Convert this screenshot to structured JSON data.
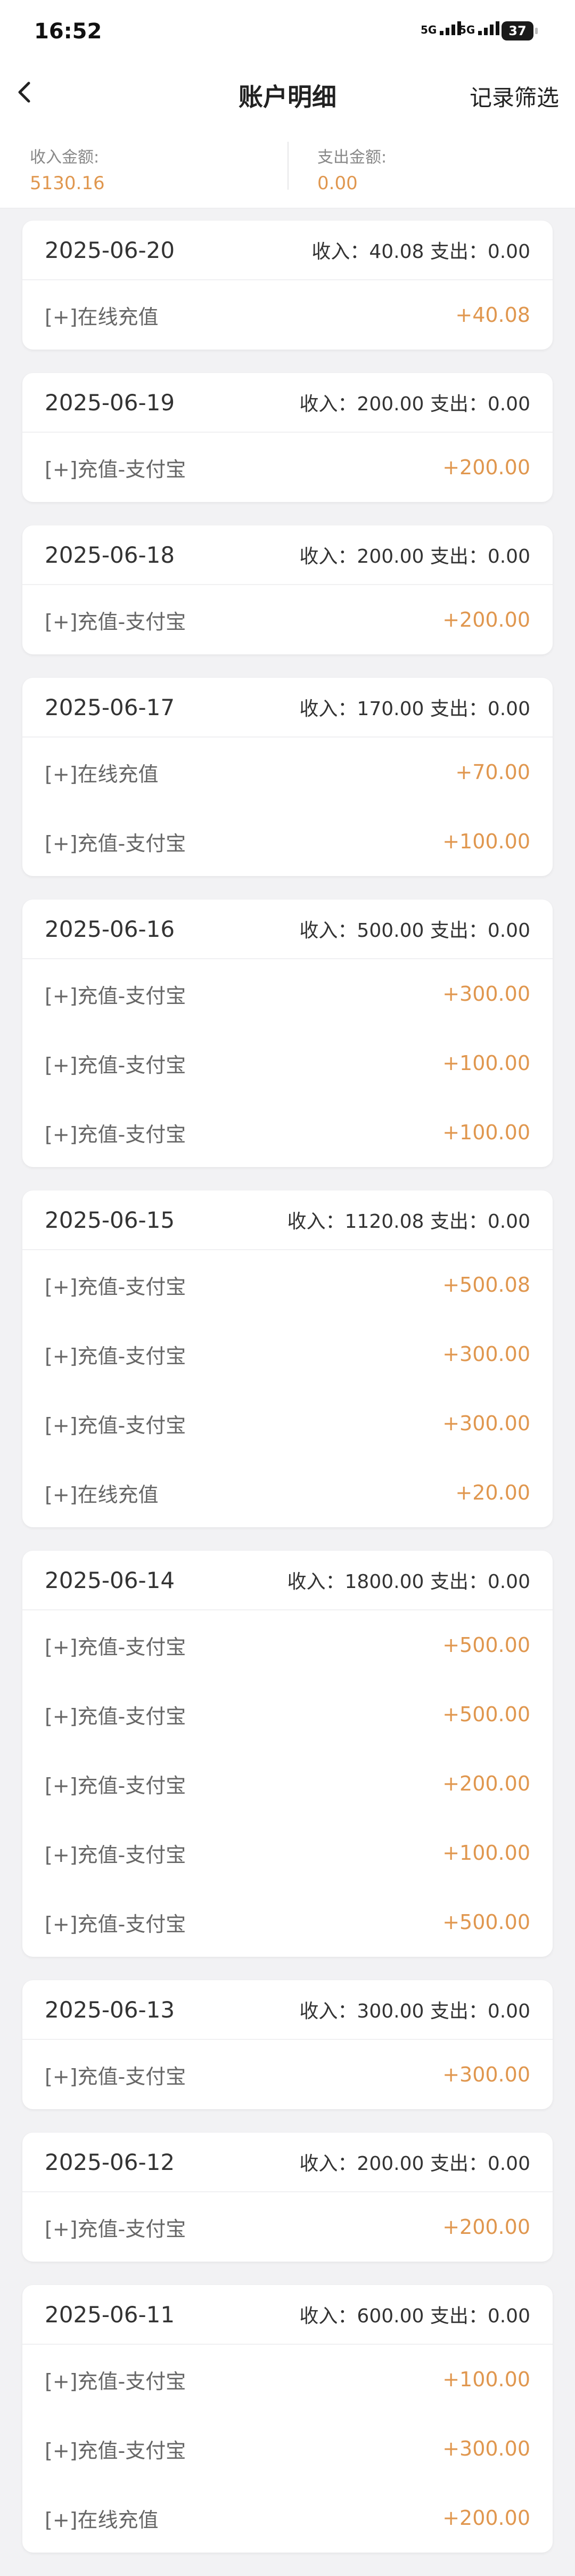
{
  "status": {
    "time": "16:52",
    "net1": "5G",
    "net2": "5G",
    "battery": "37"
  },
  "nav": {
    "title": "账户明细",
    "filter_label": "记录筛选"
  },
  "summary": {
    "income_label": "收入金额:",
    "income_value": "5130.16",
    "expense_label": "支出金额:",
    "expense_value": "0.00"
  },
  "days": [
    {
      "date": "2025-06-20",
      "summary": "收入：40.08 支出：0.00",
      "items": [
        {
          "label": "[+]在线充值",
          "amount": "+40.08"
        }
      ]
    },
    {
      "date": "2025-06-19",
      "summary": "收入：200.00 支出：0.00",
      "items": [
        {
          "label": "[+]充值-支付宝",
          "amount": "+200.00"
        }
      ]
    },
    {
      "date": "2025-06-18",
      "summary": "收入：200.00 支出：0.00",
      "items": [
        {
          "label": "[+]充值-支付宝",
          "amount": "+200.00"
        }
      ]
    },
    {
      "date": "2025-06-17",
      "summary": "收入：170.00 支出：0.00",
      "items": [
        {
          "label": "[+]在线充值",
          "amount": "+70.00"
        },
        {
          "label": "[+]充值-支付宝",
          "amount": "+100.00"
        }
      ]
    },
    {
      "date": "2025-06-16",
      "summary": "收入：500.00 支出：0.00",
      "items": [
        {
          "label": "[+]充值-支付宝",
          "amount": "+300.00"
        },
        {
          "label": "[+]充值-支付宝",
          "amount": "+100.00"
        },
        {
          "label": "[+]充值-支付宝",
          "amount": "+100.00"
        }
      ]
    },
    {
      "date": "2025-06-15",
      "summary": "收入：1120.08 支出：0.00",
      "items": [
        {
          "label": "[+]充值-支付宝",
          "amount": "+500.08"
        },
        {
          "label": "[+]充值-支付宝",
          "amount": "+300.00"
        },
        {
          "label": "[+]充值-支付宝",
          "amount": "+300.00"
        },
        {
          "label": "[+]在线充值",
          "amount": "+20.00"
        }
      ]
    },
    {
      "date": "2025-06-14",
      "summary": "收入：1800.00 支出：0.00",
      "items": [
        {
          "label": "[+]充值-支付宝",
          "amount": "+500.00"
        },
        {
          "label": "[+]充值-支付宝",
          "amount": "+500.00"
        },
        {
          "label": "[+]充值-支付宝",
          "amount": "+200.00"
        },
        {
          "label": "[+]充值-支付宝",
          "amount": "+100.00"
        },
        {
          "label": "[+]充值-支付宝",
          "amount": "+500.00"
        }
      ]
    },
    {
      "date": "2025-06-13",
      "summary": "收入：300.00 支出：0.00",
      "items": [
        {
          "label": "[+]充值-支付宝",
          "amount": "+300.00"
        }
      ]
    },
    {
      "date": "2025-06-12",
      "summary": "收入：200.00 支出：0.00",
      "items": [
        {
          "label": "[+]充值-支付宝",
          "amount": "+200.00"
        }
      ]
    },
    {
      "date": "2025-06-11",
      "summary": "收入：600.00 支出：0.00",
      "items": [
        {
          "label": "[+]充值-支付宝",
          "amount": "+100.00"
        },
        {
          "label": "[+]充值-支付宝",
          "amount": "+300.00"
        },
        {
          "label": "[+]在线充值",
          "amount": "+200.00"
        }
      ]
    }
  ]
}
